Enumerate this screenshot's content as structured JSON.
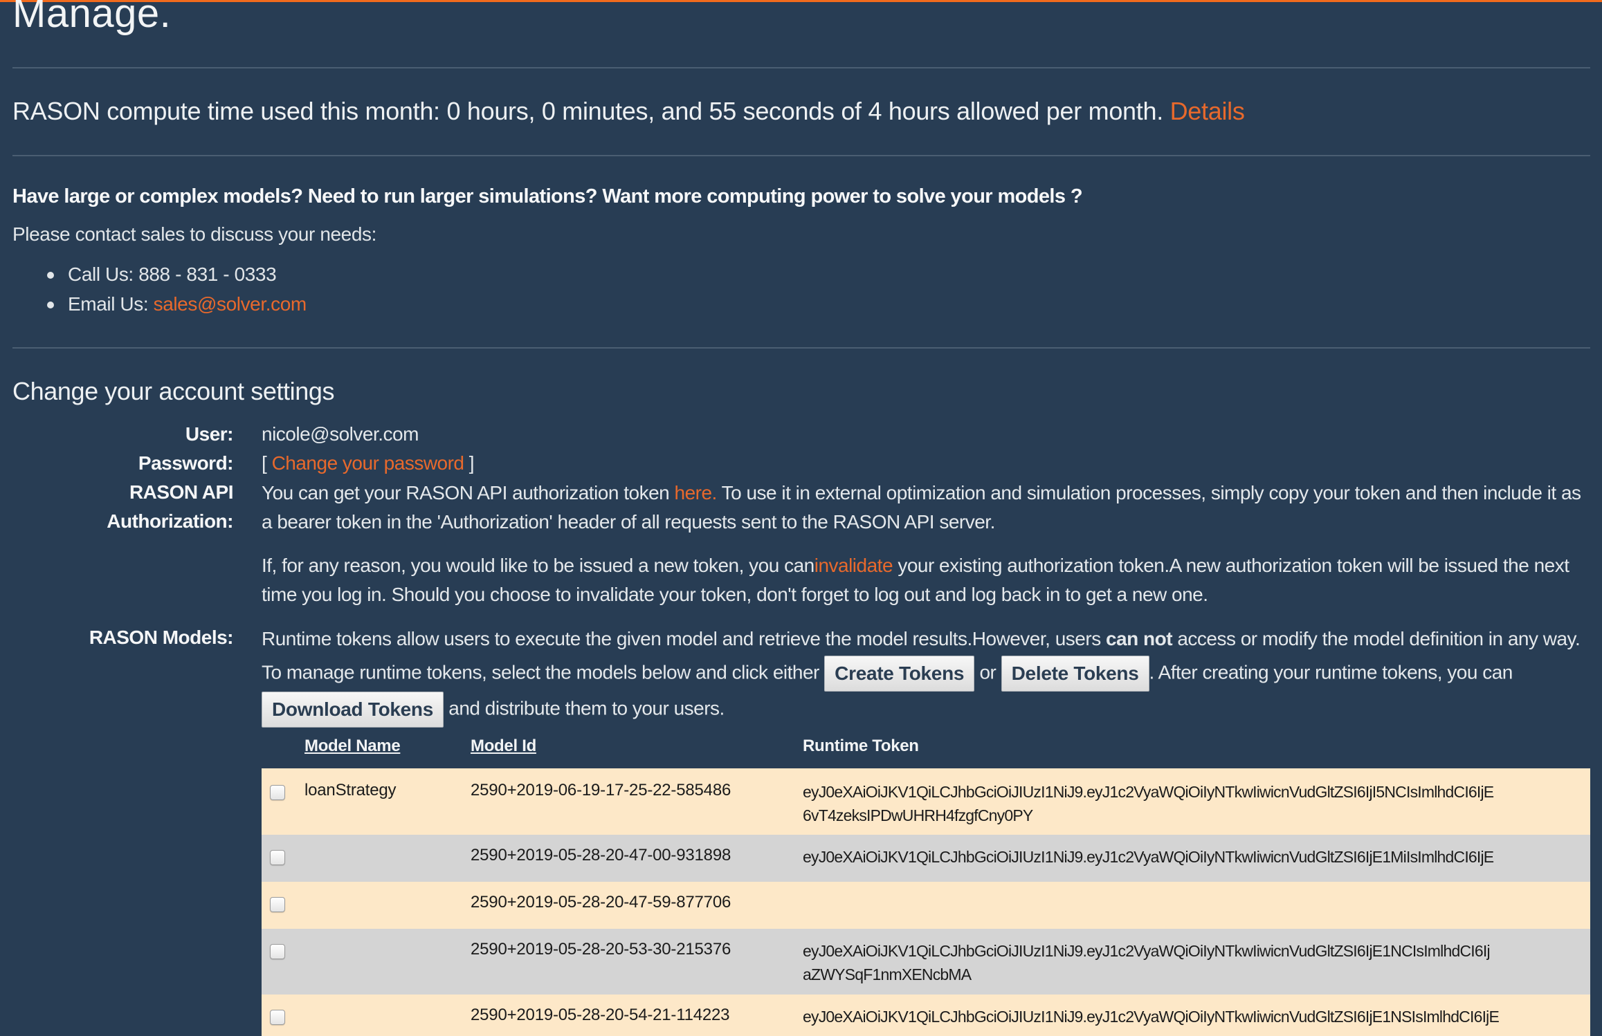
{
  "page": {
    "title": "Manage.",
    "accent_color": "#f26b1d",
    "link_color": "#e8692c",
    "background_color": "#283d54"
  },
  "usage": {
    "text": "RASON compute time used this month: 0 hours, 0 minutes, and 55 seconds of 4 hours allowed per month.",
    "details_link": "Details"
  },
  "sales": {
    "headline": "Have large or complex models? Need to run larger simulations? Want more computing power to solve your models ?",
    "intro": "Please contact sales to discuss your needs:",
    "call_label": "Call Us: 888 - 831 - 0333",
    "email_label": "Email Us:",
    "email_link": "sales@solver.com"
  },
  "settings": {
    "section_title": "Change your account settings",
    "user_label": "User:",
    "user_value": "nicole@solver.com",
    "password_label": "Password:",
    "password_open_bracket": "[",
    "password_link": "Change your password",
    "password_close_bracket": "]",
    "api_label_line1": "RASON API",
    "api_label_line2": "Authorization:",
    "api_text_before": "You can get your RASON API authorization token",
    "api_here_link": "here.",
    "api_text_after": "To use it in external optimization and simulation processes, simply copy your token and then include it as a bearer token in the 'Authorization' header of all requests sent to the RASON API server.",
    "invalidate_before": "If, for any reason, you would like to be issued a new token, you can",
    "invalidate_link": "invalidate",
    "invalidate_after": "your existing authorization token.A new authorization token will be issued the next time you log in. Should you choose to invalidate your token, don't forget to log out and log back in to get a new one.",
    "models_label": "RASON Models:",
    "models_text_1": "Runtime tokens allow users to execute the given model and retrieve the model results.However, users",
    "models_text_bold": "can not",
    "models_text_2": "access or modify the model definition in any way. To manage runtime tokens, select the models below and click either",
    "create_tokens_button": "Create Tokens",
    "models_text_or": "or",
    "delete_tokens_button": "Delete Tokens",
    "models_text_3": ". After creating your runtime tokens, you can",
    "download_tokens_button": "Download Tokens",
    "models_text_4": "and distribute them to your users."
  },
  "table": {
    "columns": [
      "Model Name",
      "Model Id",
      "Runtime Token"
    ],
    "rows": [
      {
        "checked": false,
        "model_name": "loanStrategy",
        "model_id": "2590+2019-06-19-17-25-22-585486",
        "token_line1": "eyJ0eXAiOiJKV1QiLCJhbGciOiJIUzI1NiJ9.eyJ1c2VyaWQiOiIyNTkwIiwicnVudGltZSI6IjI5NCIsImlhdCI6IjE",
        "token_line2": "6vT4zeksIPDwUHRH4fzgfCny0PY"
      },
      {
        "checked": false,
        "model_name": "",
        "model_id": "2590+2019-05-28-20-47-00-931898",
        "token_line1": "eyJ0eXAiOiJKV1QiLCJhbGciOiJIUzI1NiJ9.eyJ1c2VyaWQiOiIyNTkwIiwicnVudGltZSI6IjE1MiIsImlhdCI6IjE",
        "token_line2": ""
      },
      {
        "checked": false,
        "model_name": "",
        "model_id": "2590+2019-05-28-20-47-59-877706",
        "token_line1": "",
        "token_line2": ""
      },
      {
        "checked": false,
        "model_name": "",
        "model_id": "2590+2019-05-28-20-53-30-215376",
        "token_line1": "eyJ0eXAiOiJKV1QiLCJhbGciOiJIUzI1NiJ9.eyJ1c2VyaWQiOiIyNTkwIiwicnVudGltZSI6IjE1NCIsImlhdCI6Ij",
        "token_line2": "aZWYSqF1nmXENcbMA"
      },
      {
        "checked": false,
        "model_name": "",
        "model_id": "2590+2019-05-28-20-54-21-114223",
        "token_line1": "eyJ0eXAiOiJKV1QiLCJhbGciOiJIUzI1NiJ9.eyJ1c2VyaWQiOiIyNTkwIiwicnVudGltZSI6IjE1NSIsImlhdCI6IjE",
        "token_line2": ""
      }
    ]
  }
}
